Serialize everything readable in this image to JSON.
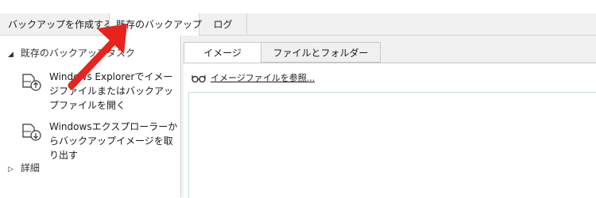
{
  "tabs": [
    {
      "label": "バックアップを作成する",
      "active": false
    },
    {
      "label": "既存のバックアップ",
      "active": true
    },
    {
      "label": "ログ",
      "active": false
    }
  ],
  "sidebar": {
    "existing_section": {
      "label": "既存のバックアップタスク",
      "expanded": true
    },
    "tasks": [
      {
        "label": "Windows Explorerでイメージファイルまたはバックアップファイルを開く",
        "icon": "open-image-icon"
      },
      {
        "label": "Windowsエクスプローラーからバックアップイメージを取り出す",
        "icon": "extract-image-icon"
      }
    ],
    "details_section": {
      "label": "詳細",
      "expanded": false
    }
  },
  "content": {
    "subtabs": [
      {
        "label": "イメージ",
        "active": true
      },
      {
        "label": "ファイルとフォルダー",
        "active": false
      }
    ],
    "browse_link": "イメージファイルを参照...",
    "browse_icon": "glasses-browse-icon"
  },
  "annotation": {
    "arrow_color": "#e8221c",
    "icon": "red-arrow-icon"
  },
  "colors": {
    "tabbar_bg": "#f0f0f0",
    "border": "#c8c8c8",
    "icon_blue": "#2a6db0"
  }
}
